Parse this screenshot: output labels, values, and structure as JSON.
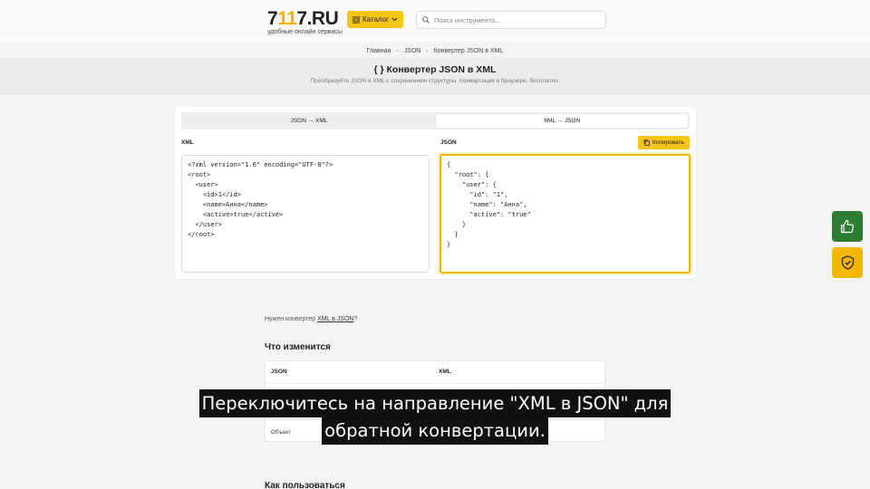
{
  "header": {
    "logo_prefix": "7",
    "logo_accent": "11",
    "logo_suffix": "7.RU",
    "logo_tagline": "удобные онлайн сервисы",
    "catalog_label": "Каталог",
    "search_placeholder": "Поиск инструмента..."
  },
  "breadcrumb": [
    "Главная",
    "JSON",
    "Конвертер JSON в XML"
  ],
  "page": {
    "title_icon": "{ }",
    "title": "Конвертер JSON в XML",
    "subtitle": "Преобразуйте JSON в XML с сохранением структуры. Конвертация в браузере, бесплатно."
  },
  "converter": {
    "tabs": [
      {
        "label": "JSON → XML",
        "active": false
      },
      {
        "label": "XML → JSON",
        "active": true
      }
    ],
    "left_label": "XML",
    "right_label": "JSON",
    "copy_label": "Копировать",
    "xml_value": "<?xml version=\"1.0\" encoding=\"UTF-8\"?>\n<root>\n  <user>\n    <id>1</id>\n    <name>Анна</name>\n    <active>true</active>\n  </user>\n</root>",
    "json_value": "{\n  \"root\": {\n    \"user\": {\n      \"id\": \"1\",\n      \"name\": \"Анна\",\n      \"active\": \"true\"\n    }\n  }\n}"
  },
  "hint": {
    "prefix": "Нужен конвертер ",
    "link": "XML в JSON",
    "suffix": "?"
  },
  "changes": {
    "heading": "Что изменится",
    "col_json": "JSON",
    "col_xml": "XML",
    "row_label": "Объект"
  },
  "how_to": {
    "heading": "Как пользоваться"
  },
  "floating": {
    "like_icon": "thumbs-up-icon",
    "shield_icon": "shield-check-icon",
    "like_color": "#2e7d32",
    "shield_color": "#f5b800"
  },
  "caption": {
    "line1": "Переключитесь на направление \"XML в JSON\" для",
    "line2": "обратной конвертации."
  }
}
